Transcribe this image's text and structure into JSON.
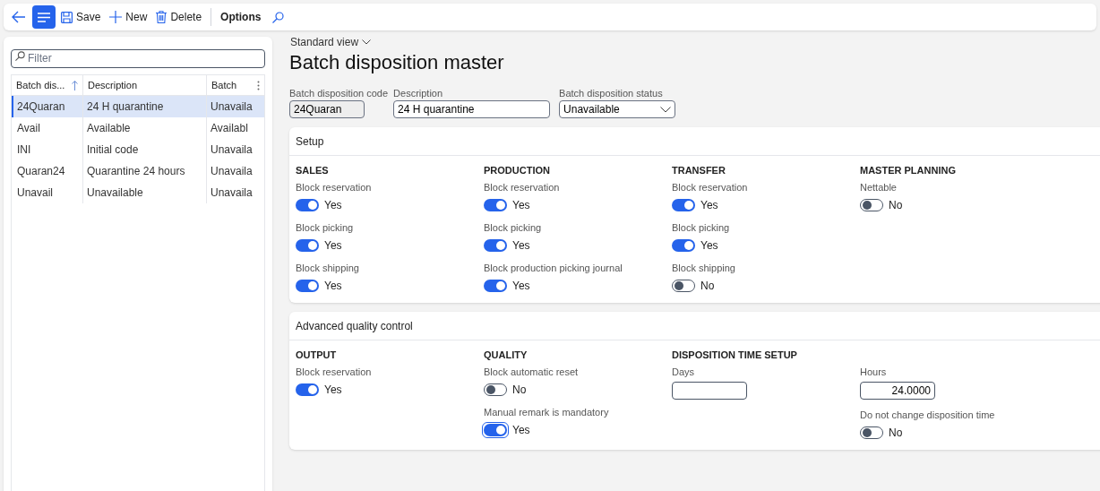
{
  "toolbar": {
    "items": [
      {
        "kind": "back"
      },
      {
        "kind": "menu",
        "selected": true
      },
      {
        "kind": "save",
        "label": "Save"
      },
      {
        "kind": "new",
        "label": "New"
      },
      {
        "kind": "delete",
        "label": "Delete"
      },
      {
        "kind": "divider"
      },
      {
        "kind": "text",
        "label": "Options"
      },
      {
        "kind": "search"
      }
    ]
  },
  "list": {
    "filter": {
      "placeholder": "Filter"
    },
    "columns": [
      {
        "label": "Batch dis...",
        "sorted": true
      },
      {
        "label": "Description",
        "sorted": false
      },
      {
        "label": "Batch",
        "sorted": false
      }
    ],
    "rows": [
      {
        "selected": true,
        "cells": [
          "24Quaran",
          "24 H quarantine",
          "Unavaila"
        ]
      },
      {
        "selected": false,
        "cells": [
          "Avail",
          "Available",
          "Availabl"
        ]
      },
      {
        "selected": false,
        "cells": [
          "INI",
          "Initial code",
          "Unavaila"
        ]
      },
      {
        "selected": false,
        "cells": [
          "Quaran24",
          "Quarantine 24 hours",
          "Unavaila"
        ]
      },
      {
        "selected": false,
        "cells": [
          "Unavail",
          "Unavailable",
          "Unavaila"
        ]
      }
    ]
  },
  "view": "Standard view",
  "title": "Batch disposition master",
  "header_fields": [
    {
      "kind": "readonly",
      "label": "Batch disposition code",
      "value": "24Quaran"
    },
    {
      "kind": "text",
      "label": "Description",
      "value": "24 H quarantine"
    },
    {
      "kind": "select",
      "label": "Batch disposition status",
      "value": "Unavailable"
    }
  ],
  "sections": [
    {
      "title": "Setup",
      "groups": [
        {
          "title": "SALES",
          "fields": [
            {
              "kind": "toggle",
              "label": "Block reservation",
              "on": true,
              "value": "Yes"
            },
            {
              "kind": "toggle",
              "label": "Block picking",
              "on": true,
              "value": "Yes"
            },
            {
              "kind": "toggle",
              "label": "Block shipping",
              "on": true,
              "value": "Yes"
            }
          ]
        },
        {
          "title": "PRODUCTION",
          "fields": [
            {
              "kind": "toggle",
              "label": "Block reservation",
              "on": true,
              "value": "Yes"
            },
            {
              "kind": "toggle",
              "label": "Block picking",
              "on": true,
              "value": "Yes"
            },
            {
              "kind": "toggle",
              "label": "Block production picking journal",
              "on": true,
              "value": "Yes"
            }
          ]
        },
        {
          "title": "TRANSFER",
          "fields": [
            {
              "kind": "toggle",
              "label": "Block reservation",
              "on": true,
              "value": "Yes"
            },
            {
              "kind": "toggle",
              "label": "Block picking",
              "on": true,
              "value": "Yes"
            },
            {
              "kind": "toggle",
              "label": "Block shipping",
              "on": false,
              "value": "No"
            }
          ]
        },
        {
          "title": "MASTER PLANNING",
          "fields": [
            {
              "kind": "toggle",
              "label": "Nettable",
              "on": false,
              "value": "No"
            }
          ]
        }
      ]
    },
    {
      "title": "Advanced quality control",
      "groups": [
        {
          "title": "OUTPUT",
          "fields": [
            {
              "kind": "toggle",
              "label": "Block reservation",
              "on": true,
              "value": "Yes"
            }
          ]
        },
        {
          "title": "QUALITY",
          "fields": [
            {
              "kind": "toggle",
              "label": "Block automatic reset",
              "on": false,
              "value": "No"
            },
            {
              "kind": "toggle",
              "label": "Manual remark is mandatory",
              "on": true,
              "focused": true,
              "value": "Yes"
            }
          ]
        },
        {
          "title": "DISPOSITION TIME SETUP",
          "fields": [
            {
              "kind": "number",
              "label": "Days"
            }
          ]
        },
        {
          "fields": [
            {
              "kind": "number",
              "label": "Hours",
              "value": "24.0000"
            },
            {
              "kind": "toggle",
              "label": "Do not change disposition time",
              "on": false,
              "value": "No"
            }
          ]
        }
      ]
    }
  ]
}
